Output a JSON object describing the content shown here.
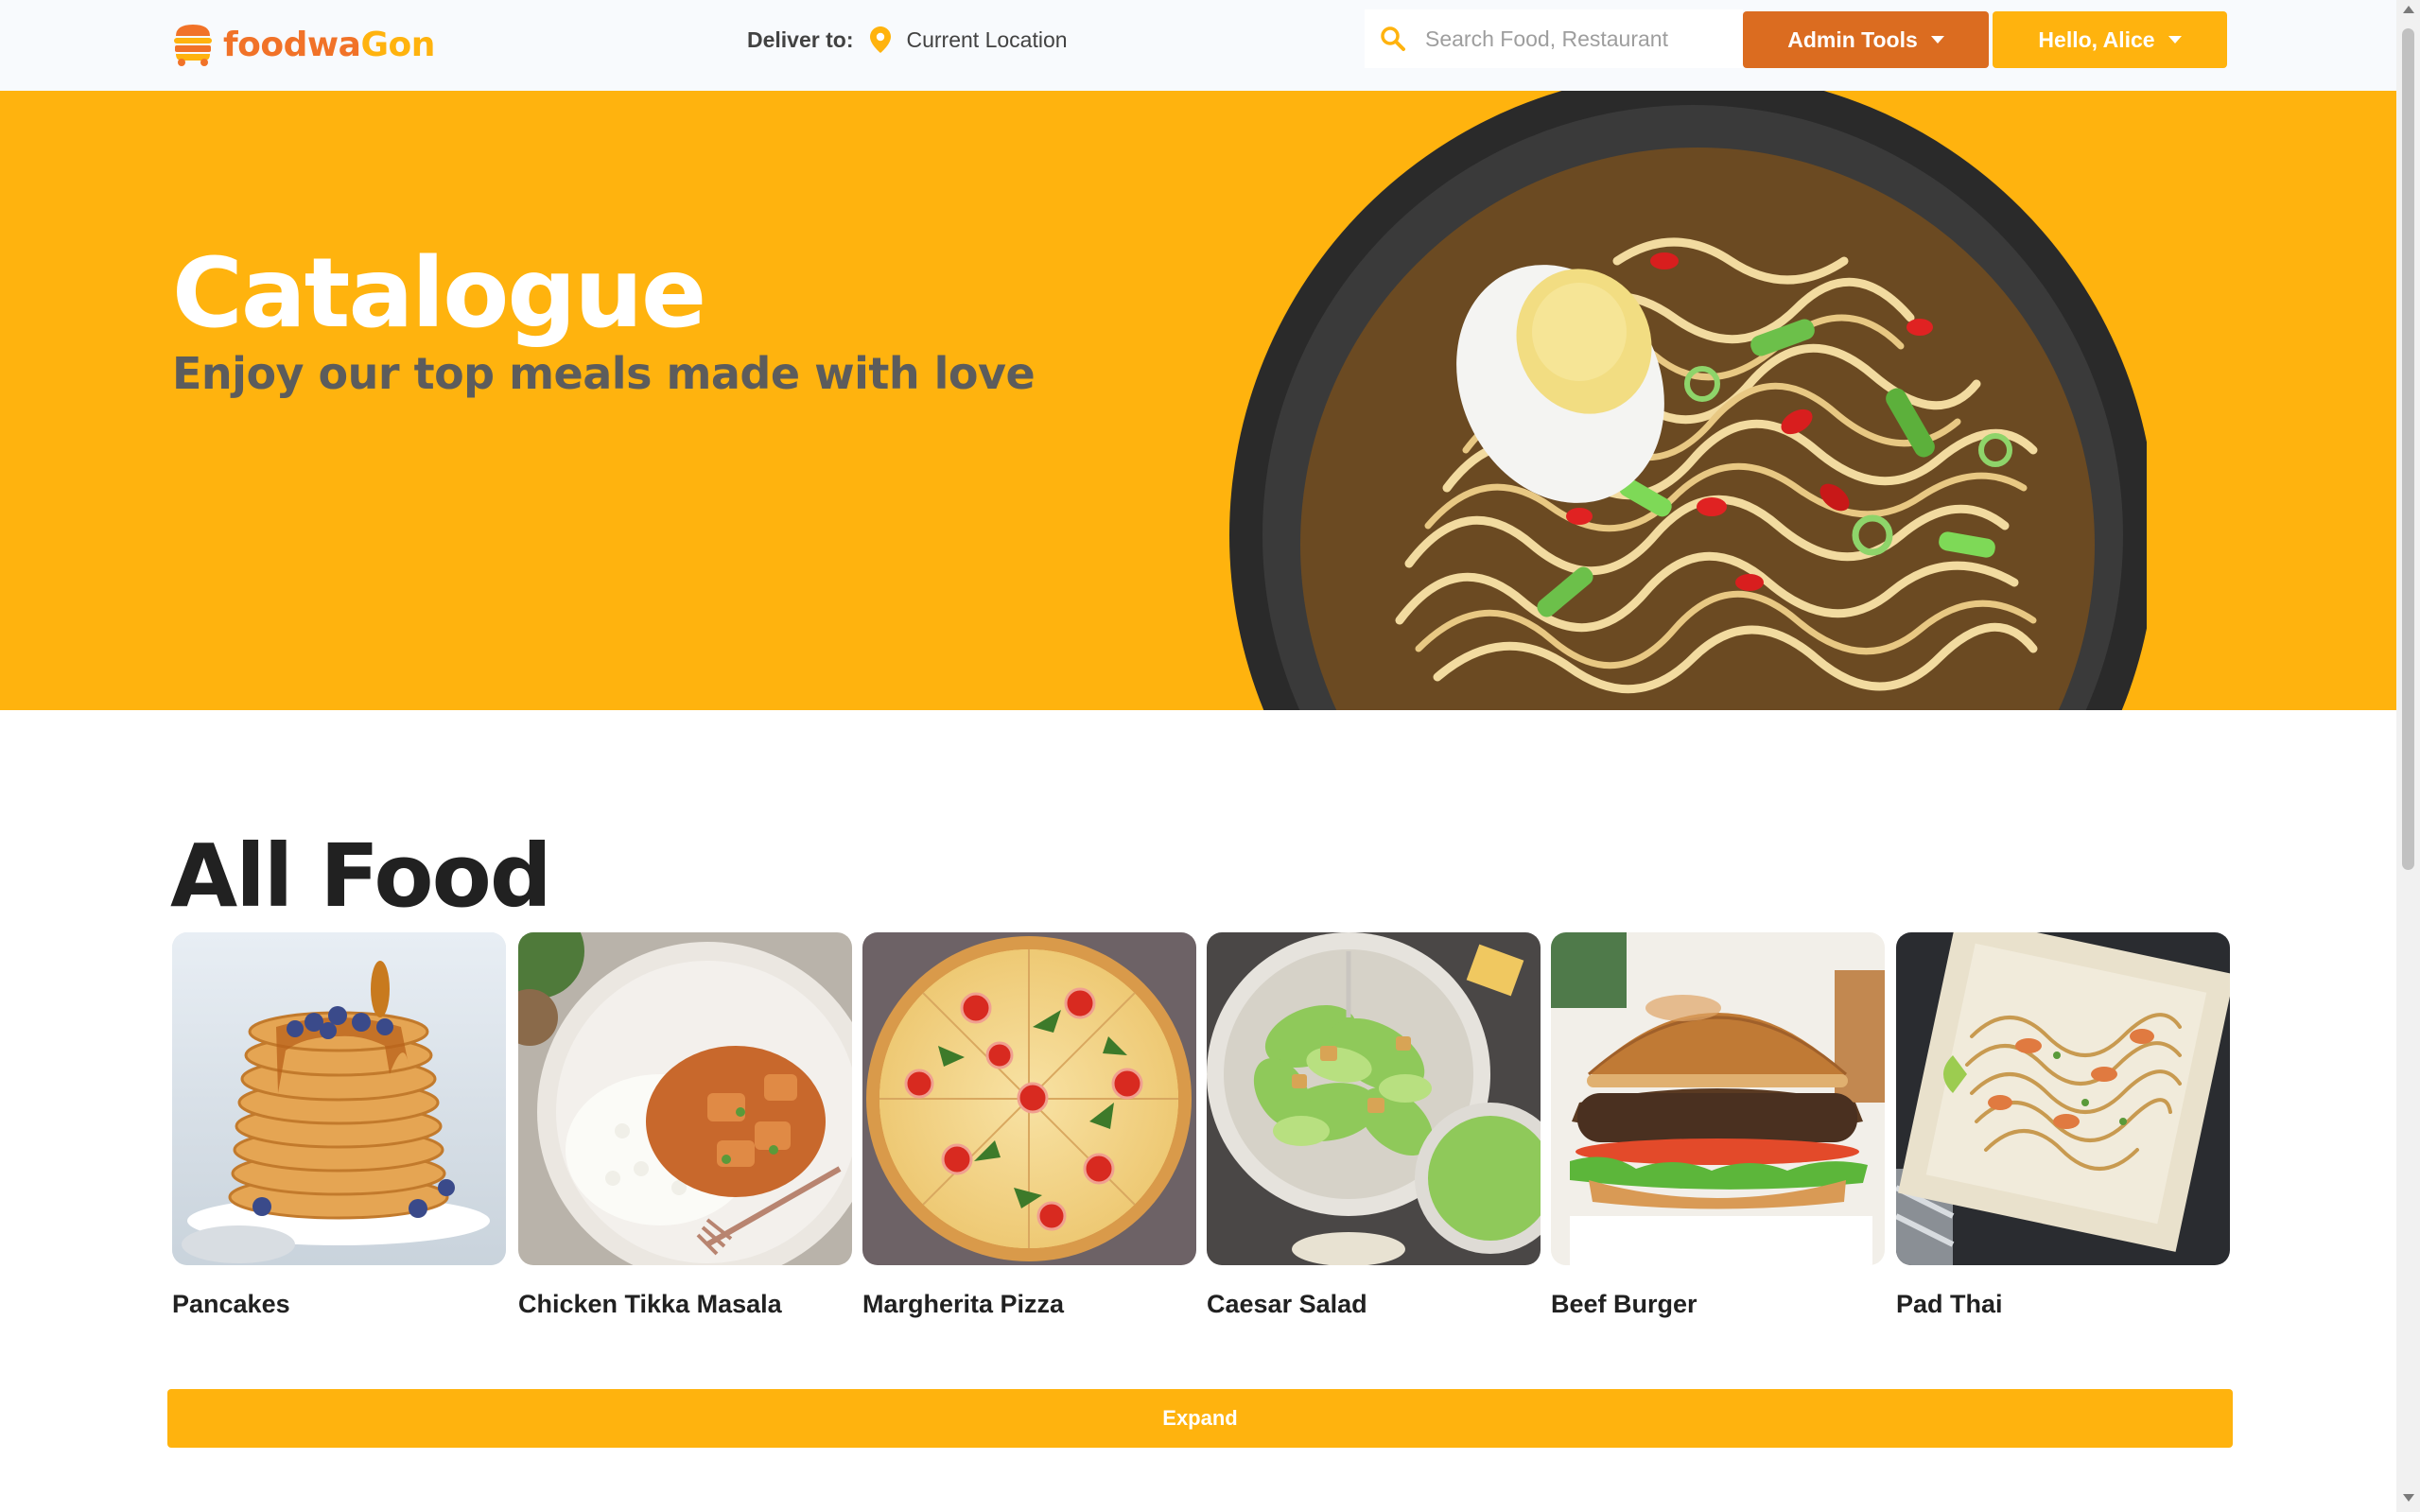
{
  "header": {
    "logo_text_1": "foodwa",
    "logo_text_2": "Gon",
    "deliver_label": "Deliver to:",
    "deliver_location": "Current Location",
    "search_placeholder": "Search Food, Restaurant",
    "admin_button": "Admin Tools",
    "user_button": "Hello, Alice"
  },
  "hero": {
    "title": "Catalogue",
    "subtitle": "Enjoy our top meals made with love"
  },
  "section": {
    "title": "All Food",
    "items": [
      {
        "name": "Pancakes"
      },
      {
        "name": "Chicken Tikka Masala"
      },
      {
        "name": "Margherita Pizza"
      },
      {
        "name": "Caesar Salad"
      },
      {
        "name": "Beef Burger"
      },
      {
        "name": "Pad Thai"
      }
    ],
    "expand_label": "Expand"
  },
  "colors": {
    "brand_orange": "#f17228",
    "brand_yellow": "#ffb30e",
    "admin_button": "#db6c20"
  }
}
